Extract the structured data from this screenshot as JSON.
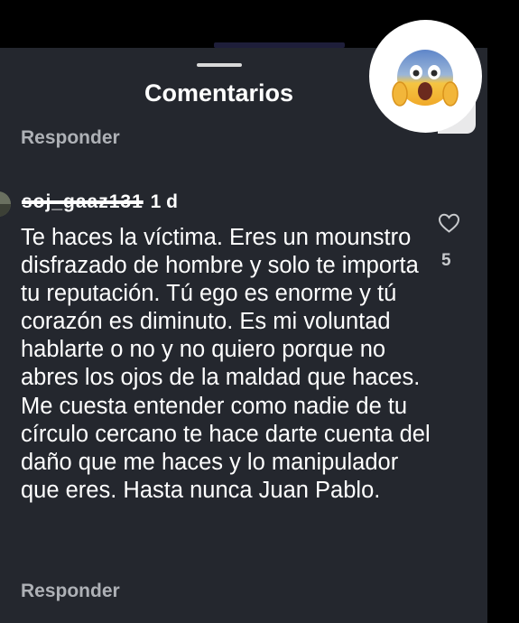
{
  "sheet": {
    "title": "Comentarios",
    "reply_top": "Responder",
    "reply_bottom": "Responder"
  },
  "reaction": {
    "emoji": "😱",
    "icon": "screaming-face-emoji"
  },
  "comment": {
    "username": "soj_gaaz131",
    "time": "1 d",
    "text": "Te haces la víctima. Eres un mounstro disfrazado de hombre y solo te importa tu reputación. Tú ego es enorme y tú corazón es diminuto. Es mi voluntad hablarte o no y no quiero porque no abres los ojos de la maldad que haces. Me cuesta entender como nadie de tu círculo cercano te hace darte cuenta del daño que me haces y lo manipulador que eres. Hasta nunca Juan Pablo.",
    "likes": "5"
  },
  "colors": {
    "panel": "#24272e",
    "background": "#000000",
    "text": "#ffffff",
    "muted": "#aeb1b6"
  }
}
